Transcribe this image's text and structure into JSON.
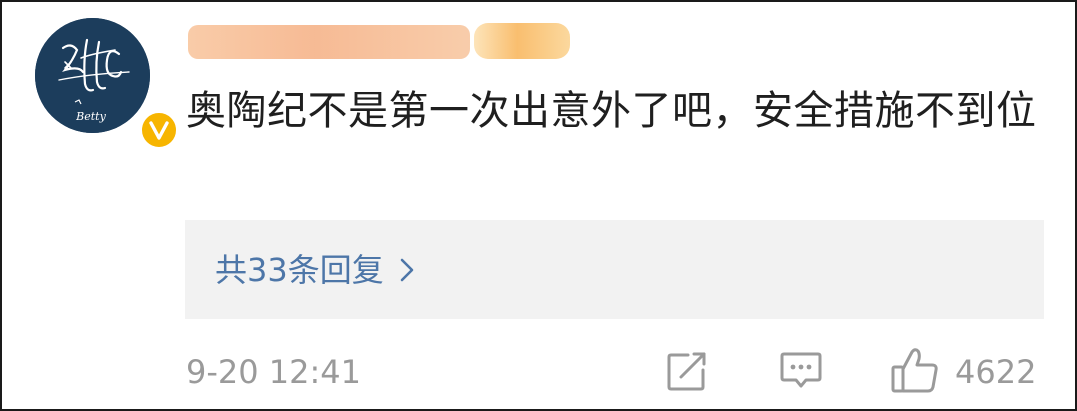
{
  "comment": {
    "author_name_blurred": "",
    "text": "奥陶纪不是第一次出意外了吧，安全措施不到位",
    "replies_label": "共33条回复",
    "timestamp": "9-20 12:41",
    "like_count": "4622",
    "avatar_text": "Betty"
  },
  "icons": {
    "verified": "verified-v-icon",
    "replies_arrow": "chevron-right-icon",
    "share": "share-icon",
    "comment": "comment-icon",
    "like": "thumbs-up-icon"
  },
  "colors": {
    "link": "#4d76a8",
    "muted": "#9a9a9a",
    "badge": "#f7b500",
    "avatar_bg": "#1c3d5c"
  }
}
